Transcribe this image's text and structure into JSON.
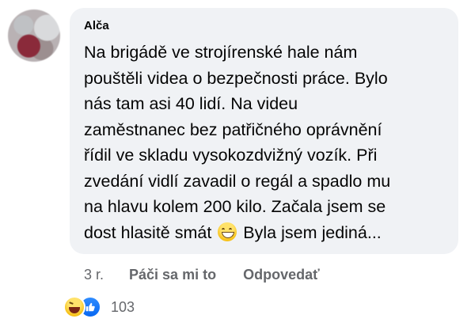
{
  "comment": {
    "author": "Alča",
    "lines": [
      "Na brigádě ve strojírenské hale nám",
      "pouštěli videa o bezpečnosti práce. Bylo",
      "nás tam asi 40 lidí. Na videu",
      "zaměstnanec bez patřičného oprávnění",
      "řídil ve skladu vysokozdvižný vozík. Při",
      "zvedání vidlí zavadil o regál a spadlo mu",
      "na hlavu kolem 200 kilo. Začala jsem se"
    ],
    "last_line_before_emoji": "dost hlasitě smát",
    "emoji": "grinning-face-icon",
    "last_line_after_emoji": "Byla jsem jediná...",
    "time": "3 r.",
    "like_label": "Páči sa mi to",
    "reply_label": "Odpovedať",
    "reaction_icons": [
      "haha-reaction-icon",
      "like-reaction-icon"
    ],
    "reaction_count": "103"
  },
  "colors": {
    "bubble": "#f0f2f5",
    "secondary_text": "#65676b",
    "like_blue": "#0868f2"
  }
}
